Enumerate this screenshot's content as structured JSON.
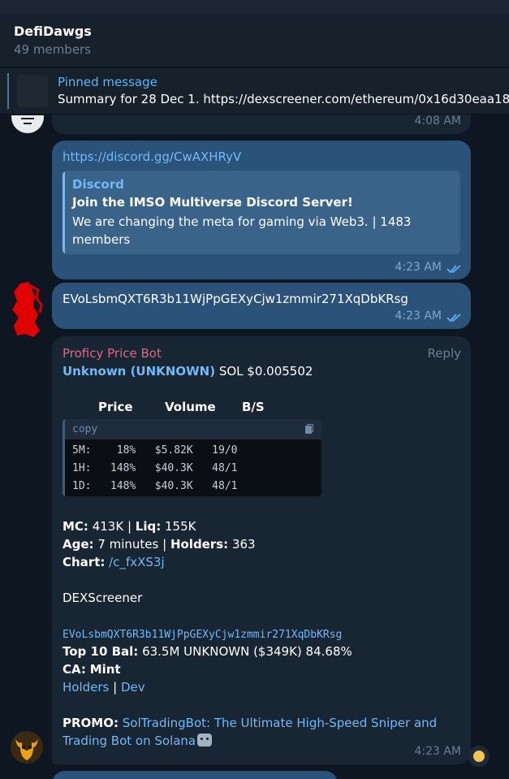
{
  "chat": {
    "title": "DefiDawgs",
    "members": "49 members"
  },
  "pinned": {
    "label": "Pinned message",
    "text": "Summary for 28 Dec  1. https://dexscreener.com/ethereum/0x16d30eaa18"
  },
  "previous": {
    "time": "4:08 AM"
  },
  "msg_link": {
    "url": "https://discord.gg/CwAXHRyV",
    "preview_site": "Discord",
    "preview_title": "Join the IMSO Multiverse Discord Server!",
    "preview_desc": "We are changing the meta for gaming via Web3. | 1483 members",
    "time": "4:23 AM"
  },
  "msg_ca": {
    "text": "EVoLsbmQXT6R3b11WjPpGEXyCjw1zmmir271XqDbKRsg",
    "time": "4:23 AM"
  },
  "bot": {
    "name": "Proficy Price Bot",
    "reply": "Reply",
    "token": "Unknown (UNKNOWN)",
    "price": "SOL $0.005502",
    "table_headers": [
      "Price",
      "Volume",
      "B/S"
    ],
    "code_label": "copy",
    "rows": [
      "5M:    18%   $5.82K   19/0",
      "1H:   148%   $40.3K   48/1",
      "1D:   148%   $40.3K   48/1"
    ],
    "mc_label": "MC:",
    "mc": "413K",
    "liq_label": "Liq:",
    "liq": "155K",
    "age_label": "Age:",
    "age": "7 minutes",
    "holders_label": "Holders:",
    "holders": "363",
    "chart_label": "Chart:",
    "chart_link": "/c_fxXS3j",
    "dexscreener": "DEXScreener",
    "ca_mono": "EVoLsbmQXT6R3b11WjPpGEXyCjw1zmmir271XqDbKRsg",
    "top10_label": "Top 10 Bal:",
    "top10": "63.5M UNKNOWN ($349K) 84.68%",
    "ca_label": "CA:",
    "ca_value": "Mint",
    "holders_link": "Holders",
    "sep": "|",
    "dev_link": "Dev",
    "promo_label": "PROMO:",
    "promo_line1": "SolTradingBot: The Ultimate High-Speed Sniper and",
    "promo_line2": "Trading Bot on Solana",
    "time": "4:23 AM"
  },
  "icons": {
    "read_ticks": "double-check-icon",
    "copy": "copy-icon",
    "robot": "robot-emoji",
    "reaction": "smile-reaction-icon"
  },
  "colors": {
    "background": "#0e1621",
    "outgoing": "#2b5278",
    "incoming": "#182533",
    "link": "#71baf9",
    "bot_name": "#e56484"
  }
}
